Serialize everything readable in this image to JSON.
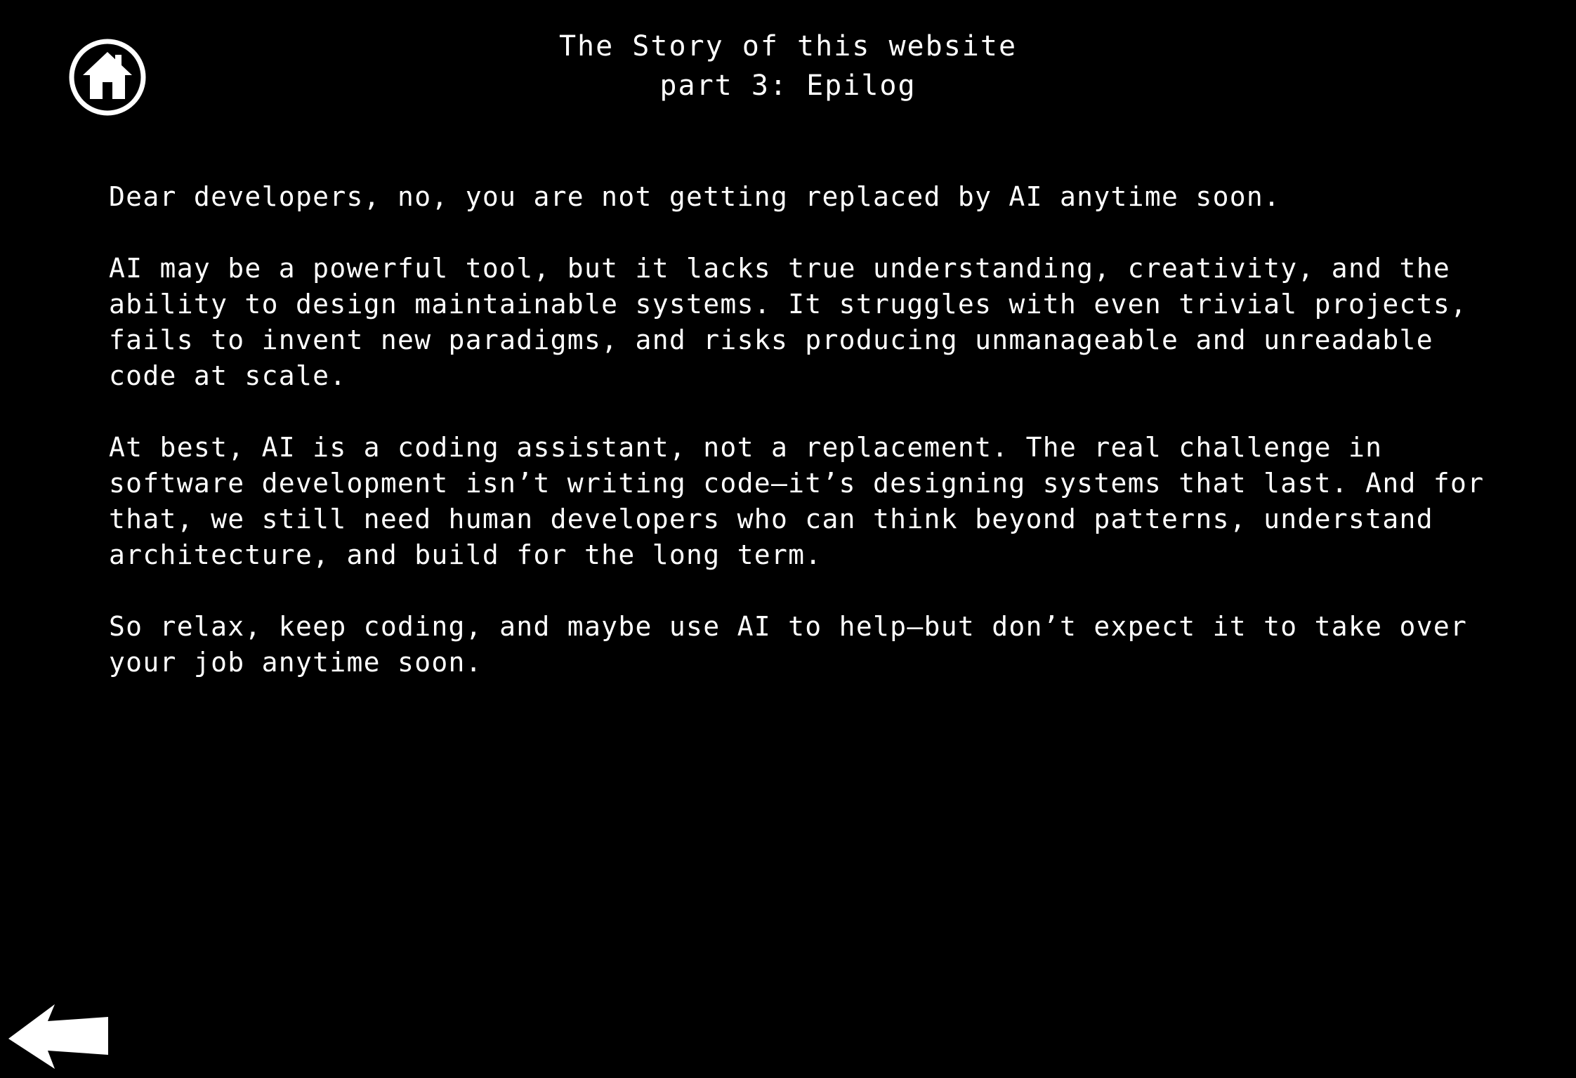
{
  "header": {
    "title": "The Story of this website",
    "subtitle": "part 3: Epilog"
  },
  "content": {
    "paragraphs": [
      "Dear developers, no, you are not getting replaced by AI anytime soon.",
      "AI may be a powerful tool, but it lacks true understanding, creativity, and the\nability to design maintainable systems. It struggles with even trivial projects,\nfails to invent new paradigms, and risks producing unmanageable and unreadable\ncode at scale.",
      "At best, AI is a coding assistant, not a replacement. The real challenge in\nsoftware development isn’t writing code—it’s designing systems that last. And for\nthat, we still need human developers who can think beyond patterns, understand\narchitecture, and build for the long term.",
      "So relax, keep coding, and maybe use AI to help—but don’t expect it to take over\nyour job anytime soon."
    ]
  },
  "navigation": {
    "home_icon": "home-icon",
    "back_icon": "arrow-left-icon"
  },
  "colors": {
    "background": "#000000",
    "text": "#ffffff"
  }
}
